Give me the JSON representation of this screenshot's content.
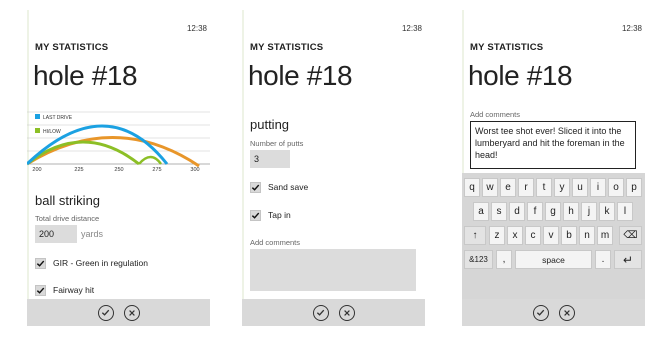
{
  "screens": [
    {
      "time": "12:38",
      "app_title": "MY STATISTICS",
      "hole_title": "hole #18",
      "chart": {
        "legend": [
          {
            "label": "LAST DRIVE",
            "color": "#1ba1e2"
          },
          {
            "label": "HI/LOW",
            "color": "#8cbf26"
          }
        ],
        "x_ticks": [
          "200",
          "225",
          "250",
          "275",
          "300"
        ]
      },
      "section_title": "ball striking",
      "drive_label": "Total drive distance",
      "drive_value": "200",
      "drive_units": "yards",
      "checks": [
        {
          "label": "GIR - Green in regulation",
          "checked": true
        },
        {
          "label": "Fairway hit",
          "checked": true
        }
      ]
    },
    {
      "time": "12:38",
      "app_title": "MY STATISTICS",
      "hole_title": "hole #18",
      "section_title": "putting",
      "putts_label": "Number of putts",
      "putts_value": "3",
      "checks": [
        {
          "label": "Sand save",
          "checked": true
        },
        {
          "label": "Tap in",
          "checked": true
        }
      ],
      "comments_label": "Add comments"
    },
    {
      "time": "12:38",
      "app_title": "MY STATISTICS",
      "hole_title": "hole #18",
      "comments_label": "Add comments",
      "comment_text": "Worst tee shot ever! Sliced it into the lumberyard and hit the foreman in the head!",
      "keyboard": {
        "row1": [
          "q",
          "w",
          "e",
          "r",
          "t",
          "y",
          "u",
          "i",
          "o",
          "p"
        ],
        "row2": [
          "a",
          "s",
          "d",
          "f",
          "g",
          "h",
          "j",
          "k",
          "l"
        ],
        "row3": [
          "z",
          "x",
          "c",
          "v",
          "b",
          "n",
          "m"
        ],
        "shift": "↑",
        "backspace": "⌫",
        "symbols": "&123",
        "comma": ",",
        "space": "space",
        "period": ".",
        "enter": "↵"
      }
    }
  ],
  "appbar": {
    "ok_icon": "check-circle-icon",
    "cancel_icon": "close-circle-icon"
  },
  "colors": {
    "accent_blue": "#1ba1e2",
    "accent_green": "#8cbf26",
    "accent_orange": "#e8962a"
  }
}
